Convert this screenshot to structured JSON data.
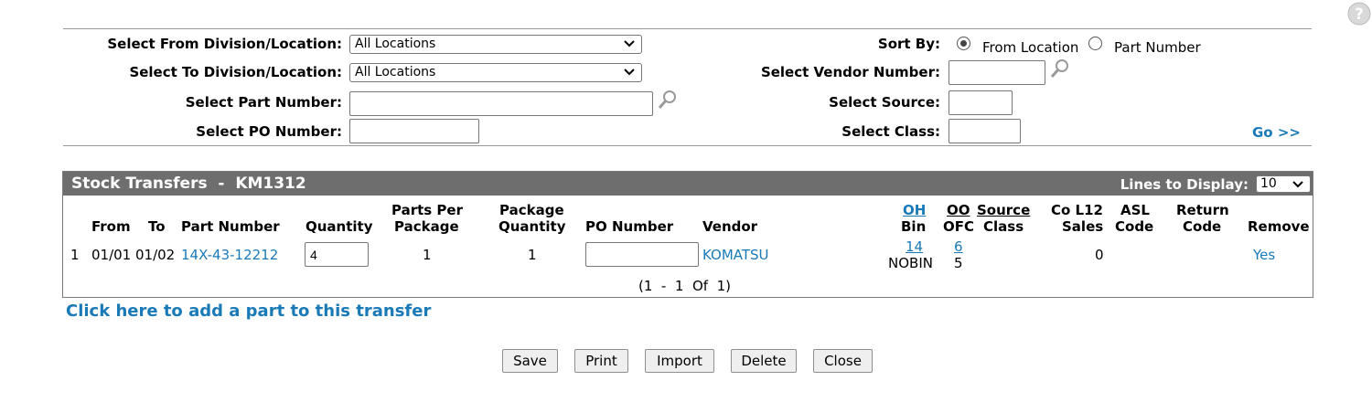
{
  "filters": {
    "from_division_label": "Select From Division/Location:",
    "from_division_value": "All Locations",
    "to_division_label": "Select To Division/Location:",
    "to_division_value": "All Locations",
    "part_number_label": "Select Part Number:",
    "part_number_value": "",
    "po_number_label": "Select PO Number:",
    "po_number_value": "",
    "sort_by_label": "Sort By:",
    "sort_options": [
      {
        "label": "From Location",
        "checked": true
      },
      {
        "label": "Part Number",
        "checked": false
      }
    ],
    "vendor_label": "Select Vendor Number:",
    "vendor_value": "",
    "source_label": "Select Source:",
    "source_value": "",
    "class_label": "Select Class:",
    "class_value": "",
    "go_link": "Go >>"
  },
  "panel": {
    "title": "Stock Transfers  -  KM1312",
    "lines_label": "Lines to Display:",
    "lines_value": "10",
    "columns": {
      "from": "From",
      "to": "To",
      "part_number": "Part Number",
      "quantity": "Quantity",
      "parts_per_package_1": "Parts Per",
      "parts_per_package_2": "Package",
      "package_quantity_1": "Package",
      "package_quantity_2": "Quantity",
      "po_number": "PO Number",
      "vendor": "Vendor",
      "oh": "OH",
      "bin": "Bin",
      "oo": "OO",
      "ofc": "OFC",
      "source": "Source",
      "class": "Class",
      "co_l12": "Co L12",
      "sales": "Sales",
      "asl": "ASL",
      "code": "Code",
      "return": "Return",
      "return_code": "Code",
      "remove": "Remove"
    },
    "rows": [
      {
        "line": "1",
        "from": "01/01",
        "to": "01/02",
        "part_number": "14X-43-12212",
        "quantity": "4",
        "parts_per_package": "1",
        "package_quantity": "1",
        "po_number": "",
        "vendor": "KOMATSU",
        "oh": "14",
        "bin": "NOBIN",
        "oo": "6",
        "ofc": "5",
        "sales": "0",
        "remove": "Yes"
      }
    ],
    "pagination": "(1  -  1  Of  1)"
  },
  "add_part_link": "Click here to add a part to this transfer",
  "buttons": {
    "save": "Save",
    "print": "Print",
    "import": "Import",
    "delete": "Delete",
    "close": "Close"
  },
  "help_icon": "question-icon",
  "colors": {
    "link": "#1a7ab8",
    "panel_header": "#6e6e6e"
  }
}
